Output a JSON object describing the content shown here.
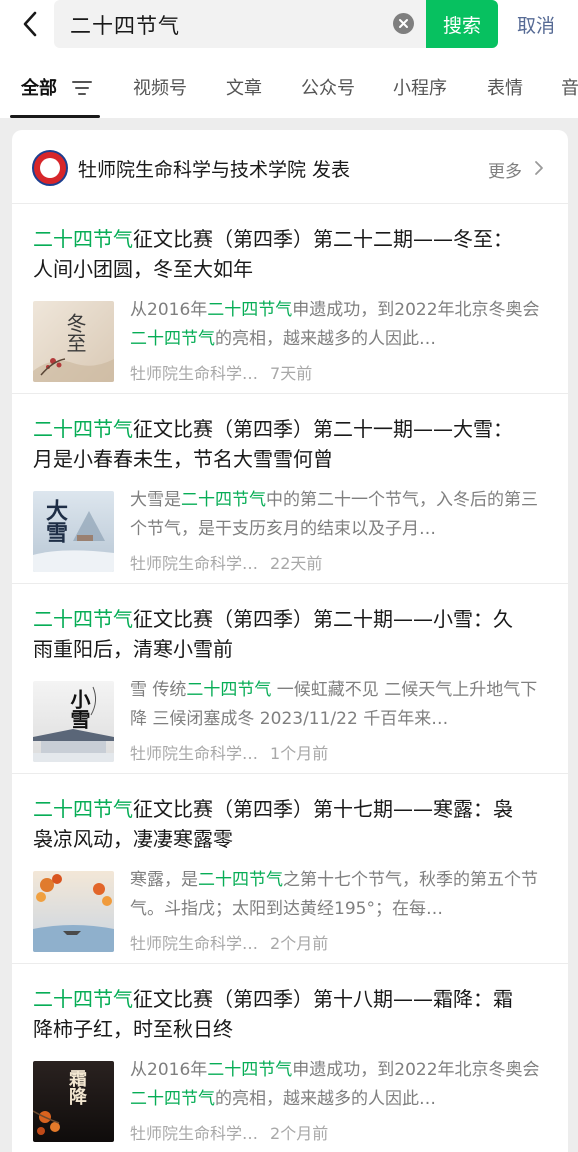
{
  "search": {
    "query": "二十四节气",
    "search_label": "搜索",
    "cancel_label": "取消"
  },
  "tabs": [
    {
      "label": "全部"
    },
    {
      "label": "视频号"
    },
    {
      "label": "文章"
    },
    {
      "label": "公众号"
    },
    {
      "label": "小程序"
    },
    {
      "label": "表情"
    },
    {
      "label": "音"
    }
  ],
  "account": {
    "title": "牡师院生命科学与技术学院 发表",
    "more_label": "更多"
  },
  "results": [
    {
      "title_hl": "二十四节气",
      "title_rest": "征文比赛（第四季）第二十二期——冬至：人间小团圆，冬至大如年",
      "desc_parts": [
        "从2016年",
        "二十四节气",
        "申遗成功，到2022年北京冬奥会",
        "二十四节气",
        "的亮相，越来越多的人因此…"
      ],
      "source": "牡师院生命科学…",
      "time": "7天前",
      "thumb_text": "冬至"
    },
    {
      "title_hl": "二十四节气",
      "title_rest": "征文比赛（第四季）第二十一期——大雪：月是小春春未生，节名大雪雪何曾",
      "desc_parts": [
        "大雪是",
        "二十四节气",
        "中的第二十一个节气，入冬后的第三个节气，是干支历亥月的结束以及子月…",
        "",
        ""
      ],
      "source": "牡师院生命科学…",
      "time": "22天前",
      "thumb_text": "大雪"
    },
    {
      "title_hl": "二十四节气",
      "title_rest": "征文比赛（第四季）第二十期——小雪：久雨重阳后，清寒小雪前",
      "desc_parts": [
        "雪 传统",
        "二十四节气",
        " 一候虹藏不见 二候天气上升地气下降 三候闭塞成冬 2023/11/22 千百年来…",
        "",
        ""
      ],
      "source": "牡师院生命科学…",
      "time": "1个月前",
      "thumb_text": "小雪"
    },
    {
      "title_hl": "二十四节气",
      "title_rest": "征文比赛（第四季）第十七期——寒露：袅袅凉风动，凄凄寒露零",
      "desc_parts": [
        "寒露，是",
        "二十四节气",
        "之第十七个节气，秋季的第五个节气。斗指戊；太阳到达黄经195°；在每…",
        "",
        ""
      ],
      "source": "牡师院生命科学…",
      "time": "2个月前",
      "thumb_text": ""
    },
    {
      "title_hl": "二十四节气",
      "title_rest": "征文比赛（第四季）第十八期——霜降：霜降柿子红，时至秋日终",
      "desc_parts": [
        "从2016年",
        "二十四节气",
        "申遗成功，到2022年北京冬奥会",
        "二十四节气",
        "的亮相，越来越多的人因此…"
      ],
      "source": "牡师院生命科学…",
      "time": "2个月前",
      "thumb_text": "霜降"
    }
  ],
  "colors": {
    "accent_green": "#07c160",
    "highlight_green": "#07ad56",
    "link_blue": "#576b95"
  }
}
